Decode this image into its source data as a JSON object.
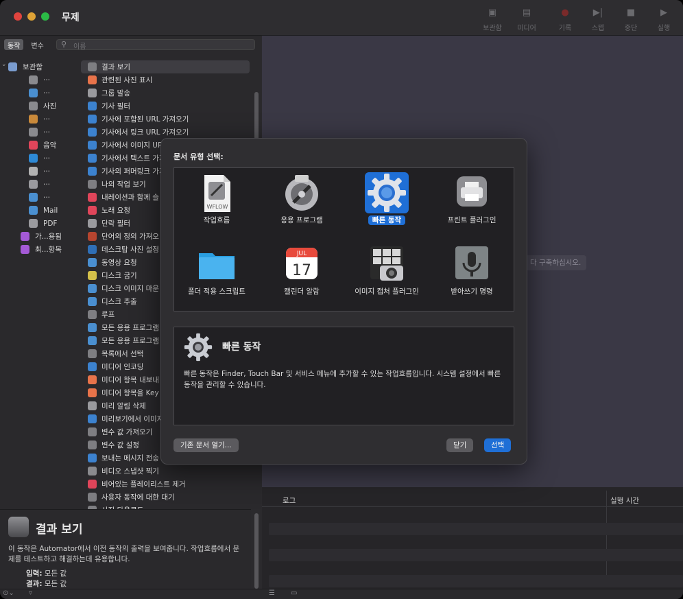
{
  "window": {
    "title": "무제"
  },
  "toolbar": {
    "library": "보관함",
    "media": "미디어",
    "record": "기록",
    "step": "스텝",
    "stop": "중단",
    "run": "실행"
  },
  "left": {
    "tabs": [
      "동작",
      "변수"
    ],
    "search_placeholder": "이름",
    "library": [
      {
        "label": "보관함",
        "color": "#7a9ccf"
      },
      {
        "label": "···",
        "color": "#8a8a8e"
      },
      {
        "label": "···",
        "color": "#4a8fd0"
      },
      {
        "label": "사진",
        "color": "#8a8a8e"
      },
      {
        "label": "···",
        "color": "#c9893a"
      },
      {
        "label": "···",
        "color": "#8a8a8e"
      },
      {
        "label": "음악",
        "color": "#e0455a"
      },
      {
        "label": "···",
        "color": "#2e8ad6"
      },
      {
        "label": "···",
        "color": "#b2b2b2"
      },
      {
        "label": "···",
        "color": "#9a9a9e"
      },
      {
        "label": "···",
        "color": "#4a8fd0"
      },
      {
        "label": "Mail",
        "color": "#4a8fd0"
      },
      {
        "label": "PDF",
        "color": "#9a9a9e"
      },
      {
        "label": "가...용됨",
        "color": "#a45ad6"
      },
      {
        "label": "최...항목",
        "color": "#a45ad6"
      }
    ],
    "actions": [
      "결과 보기",
      "관련된 사진 표시",
      "그룹 발송",
      "기사 필터",
      "기사에 포함된 URL 가져오기",
      "기사에서 링크 URL 가져오기",
      "기사에서 이미지 URL",
      "기사에서 텍스트 가져",
      "기사의 퍼머링크 가져",
      "나의 작업 보기",
      "내레이션과 함께 슬",
      "노래 요청",
      "단락 필터",
      "단어의 정의 가져오",
      "데스크탑 사진 설정",
      "동영상 요청",
      "디스크 굽기",
      "디스크 이미지 마운",
      "디스크 추출",
      "루프",
      "모든 응용 프로그램",
      "모든 응용 프로그램",
      "목록에서 선택",
      "미디어 인코딩",
      "미디어 항목 내보내",
      "미디어 항목을 Key",
      "미리 알림 삭제",
      "미리보기에서 이미지",
      "변수 값 가져오기",
      "변수 값 설정",
      "보내는 메시지 전송",
      "비디오 스냅샷 찍기",
      "비어있는 플레이리스트 제거",
      "사용자 동작에 대한 대기",
      "사진 다운로드"
    ],
    "action_colors": [
      "#7e7e82",
      "#e8734a",
      "#9a9a9e",
      "#3c82cf",
      "#3c82cf",
      "#3c82cf",
      "#3c82cf",
      "#3c82cf",
      "#3c82cf",
      "#7e7e82",
      "#e0455a",
      "#e0455a",
      "#9a9a9e",
      "#b6452f",
      "#2f6fb6",
      "#4a8fd0",
      "#d4c04a",
      "#4a8fd0",
      "#4a8fd0",
      "#7e7e82",
      "#4a8fd0",
      "#4a8fd0",
      "#7e7e82",
      "#3c82cf",
      "#e8734a",
      "#e8734a",
      "#9a9a9e",
      "#3c82cf",
      "#7e7e82",
      "#7e7e82",
      "#3c82cf",
      "#8a8a8e",
      "#e0455a",
      "#7e7e82",
      "#7e7e82"
    ]
  },
  "description": {
    "title": "결과 보기",
    "text": "이 동작은 Automator에서 이전 동작의 출력을 보여줍니다. 작업흐름에서 문제를 테스트하고 해결하는데 유용합니다.",
    "input_label": "입력:",
    "input_value": "모든 값",
    "result_label": "결과:",
    "result_value": "모든 값"
  },
  "workflow": {
    "hint": "다 구축하십시오.",
    "log_col": "로그",
    "time_col": "실행 시간"
  },
  "modal": {
    "title": "문서 유형 선택:",
    "types": [
      {
        "label": "작업흐름",
        "icon": "workflow-document-icon"
      },
      {
        "label": "응용 프로그램",
        "icon": "application-icon"
      },
      {
        "label": "빠른 동작",
        "icon": "gear-icon",
        "selected": true
      },
      {
        "label": "프린트 플러그인",
        "icon": "printer-icon"
      },
      {
        "label": "폴더 적용 스크립트",
        "icon": "folder-icon"
      },
      {
        "label": "캘린더 알람",
        "icon": "calendar-icon"
      },
      {
        "label": "이미지 캡처 플러그인",
        "icon": "image-capture-icon"
      },
      {
        "label": "받아쓰기 명령",
        "icon": "microphone-icon"
      }
    ],
    "workflow_doc_tag": "WFLOW",
    "calendar_month": "JUL",
    "calendar_day": "17",
    "info_title": "빠른 동작",
    "info_text": "빠른 동작은 Finder, Touch Bar 및 서비스 메뉴에 추가할 수 있는 작업흐름입니다. 시스템 설정에서 빠른 동작을 관리할 수 있습니다.",
    "open_existing": "기존 문서 열기...",
    "close": "닫기",
    "choose": "선택"
  }
}
